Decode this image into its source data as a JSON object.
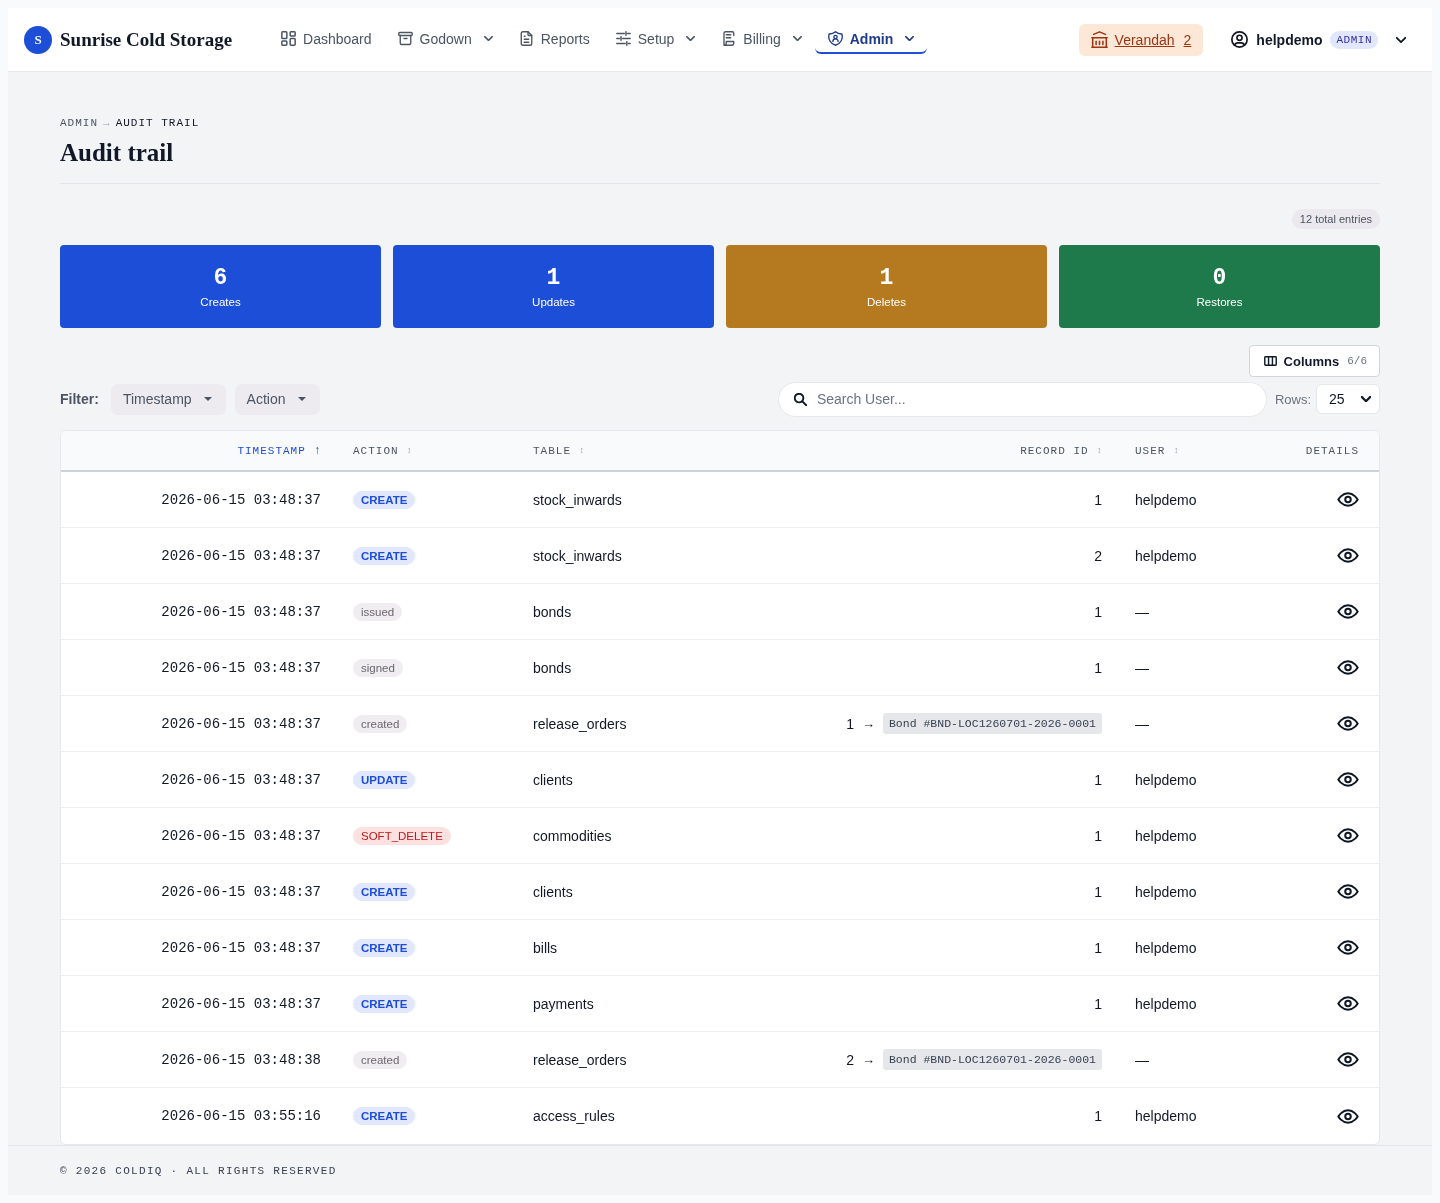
{
  "nav": {
    "logo_letter": "S",
    "brand": "Sunrise Cold Storage",
    "items": [
      {
        "label": "Dashboard",
        "dropdown": false,
        "selected": false
      },
      {
        "label": "Godown",
        "dropdown": true,
        "selected": false
      },
      {
        "label": "Reports",
        "dropdown": false,
        "selected": false
      },
      {
        "label": "Setup",
        "dropdown": true,
        "selected": false
      },
      {
        "label": "Billing",
        "dropdown": true,
        "selected": false
      },
      {
        "label": "Admin",
        "dropdown": true,
        "selected": true
      }
    ],
    "location": {
      "label": "Verandah",
      "count": "2"
    },
    "user": {
      "name": "helpdemo",
      "role": "ADMIN"
    }
  },
  "breadcrumb": {
    "parent": "ADMIN",
    "separator": "→",
    "current": "AUDIT TRAIL"
  },
  "title": "Audit trail",
  "total_entries": "12 total entries",
  "stats": [
    {
      "value": "6",
      "label": "Creates",
      "color": "#1d4ed8"
    },
    {
      "value": "1",
      "label": "Updates",
      "color": "#1d4ed8"
    },
    {
      "value": "1",
      "label": "Deletes",
      "color": "#b57a20"
    },
    {
      "value": "0",
      "label": "Restores",
      "color": "#1f7a4b"
    }
  ],
  "columns_button": {
    "label": "Columns",
    "count": "6/6"
  },
  "filter": {
    "label": "Filter:",
    "chips": [
      "Timestamp",
      "Action"
    ]
  },
  "search": {
    "placeholder": "Search User..."
  },
  "rows_select": {
    "label": "Rows:",
    "value": "25"
  },
  "table": {
    "columns": [
      {
        "label": "TIMESTAMP",
        "sort": "↑",
        "selected": true
      },
      {
        "label": "ACTION",
        "sort": "↕",
        "selected": false
      },
      {
        "label": "TABLE",
        "sort": "↕",
        "selected": false
      },
      {
        "label": "RECORD ID",
        "sort": "↕",
        "selected": false
      },
      {
        "label": "USER",
        "sort": "↕",
        "selected": false
      },
      {
        "label": "DETAILS",
        "selected": false
      }
    ],
    "rows": [
      {
        "timestamp": "2026-06-15 03:48:37",
        "action": {
          "label": "CREATE",
          "kind": "create"
        },
        "table": "stock_inwards",
        "record_id": "1",
        "user": "helpdemo"
      },
      {
        "timestamp": "2026-06-15 03:48:37",
        "action": {
          "label": "CREATE",
          "kind": "create"
        },
        "table": "stock_inwards",
        "record_id": "2",
        "user": "helpdemo"
      },
      {
        "timestamp": "2026-06-15 03:48:37",
        "action": {
          "label": "issued",
          "kind": "event"
        },
        "table": "bonds",
        "record_id": "1",
        "user": "—"
      },
      {
        "timestamp": "2026-06-15 03:48:37",
        "action": {
          "label": "signed",
          "kind": "event"
        },
        "table": "bonds",
        "record_id": "1",
        "user": "—"
      },
      {
        "timestamp": "2026-06-15 03:48:37",
        "action": {
          "label": "created",
          "kind": "event"
        },
        "table": "release_orders",
        "record_id": "1",
        "reference": {
          "arrow": "→",
          "label": "Bond #BND-LOC1260701-2026-0001"
        },
        "user": "—"
      },
      {
        "timestamp": "2026-06-15 03:48:37",
        "action": {
          "label": "UPDATE",
          "kind": "update"
        },
        "table": "clients",
        "record_id": "1",
        "user": "helpdemo"
      },
      {
        "timestamp": "2026-06-15 03:48:37",
        "action": {
          "label": "SOFT_DELETE",
          "kind": "delete"
        },
        "table": "commodities",
        "record_id": "1",
        "user": "helpdemo"
      },
      {
        "timestamp": "2026-06-15 03:48:37",
        "action": {
          "label": "CREATE",
          "kind": "create"
        },
        "table": "clients",
        "record_id": "1",
        "user": "helpdemo"
      },
      {
        "timestamp": "2026-06-15 03:48:37",
        "action": {
          "label": "CREATE",
          "kind": "create"
        },
        "table": "bills",
        "record_id": "1",
        "user": "helpdemo"
      },
      {
        "timestamp": "2026-06-15 03:48:37",
        "action": {
          "label": "CREATE",
          "kind": "create"
        },
        "table": "payments",
        "record_id": "1",
        "user": "helpdemo"
      },
      {
        "timestamp": "2026-06-15 03:48:38",
        "action": {
          "label": "created",
          "kind": "event"
        },
        "table": "release_orders",
        "record_id": "2",
        "reference": {
          "arrow": "→",
          "label": "Bond #BND-LOC1260701-2026-0001"
        },
        "user": "—"
      },
      {
        "timestamp": "2026-06-15 03:55:16",
        "action": {
          "label": "CREATE",
          "kind": "create"
        },
        "table": "access_rules",
        "record_id": "1",
        "user": "helpdemo"
      }
    ]
  },
  "footer": "© 2026 COLDIQ · ALL RIGHTS RESERVED"
}
